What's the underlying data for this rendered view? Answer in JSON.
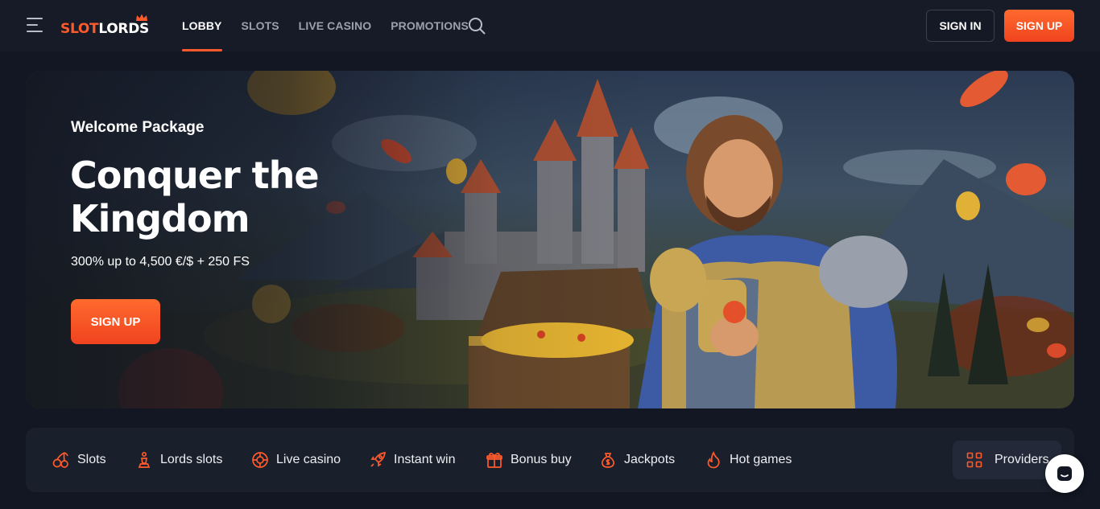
{
  "brand": {
    "logo_part1": "SLOT",
    "logo_part2": "LORDS"
  },
  "nav": {
    "items": [
      {
        "label": "LOBBY",
        "active": true
      },
      {
        "label": "SLOTS",
        "active": false
      },
      {
        "label": "LIVE CASINO",
        "active": false
      },
      {
        "label": "PROMOTIONS",
        "active": false
      }
    ]
  },
  "header": {
    "sign_in": "SIGN IN",
    "sign_up": "SIGN UP"
  },
  "hero": {
    "eyebrow": "Welcome Package",
    "title": "Conquer the Kingdom",
    "subtitle": "300% up to 4,500 €/$ + 250 FS",
    "cta": "SIGN UP"
  },
  "categories": [
    {
      "label": "Slots",
      "icon": "cherries-icon"
    },
    {
      "label": "Lords slots",
      "icon": "chess-piece-icon"
    },
    {
      "label": "Live casino",
      "icon": "roulette-icon"
    },
    {
      "label": "Instant win",
      "icon": "rocket-icon"
    },
    {
      "label": "Bonus buy",
      "icon": "gift-icon"
    },
    {
      "label": "Jackpots",
      "icon": "money-bag-icon"
    },
    {
      "label": "Hot games",
      "icon": "flame-icon"
    }
  ],
  "providers": {
    "label": "Providers",
    "icon": "grid-icon"
  },
  "colors": {
    "accent": "#ff5a2b",
    "background": "#121723",
    "surface": "#1a1f2c"
  }
}
